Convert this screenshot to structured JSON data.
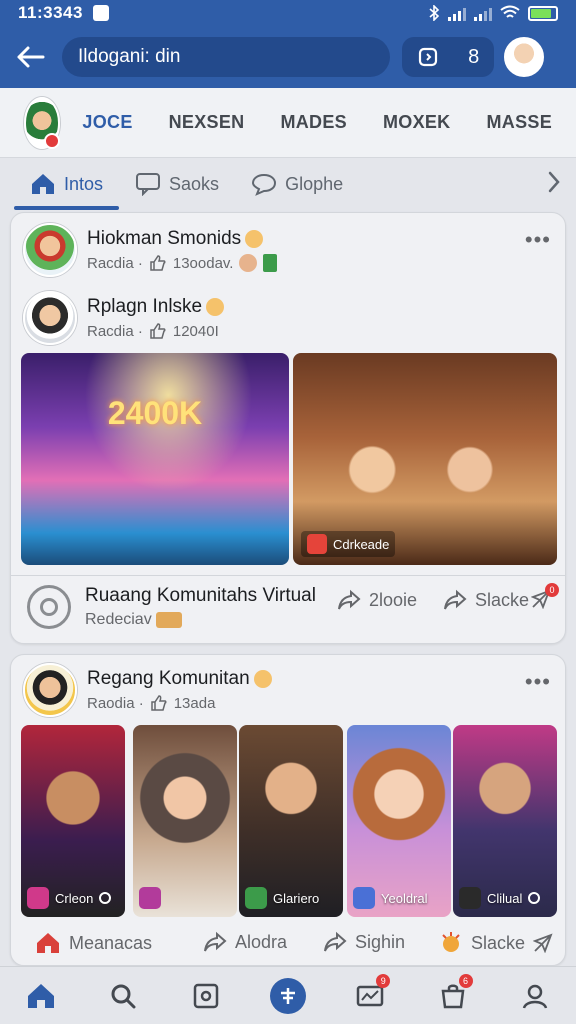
{
  "status_bar": {
    "time": "11:3343"
  },
  "top_bar": {
    "search_text": "Ildogani: din",
    "pill_number": "8"
  },
  "stories": [
    "JOCE",
    "NEXSEN",
    "MADES",
    "MOXEK",
    "MΑSSE"
  ],
  "tabs": [
    {
      "label": "Intos",
      "icon": "home-icon"
    },
    {
      "label": "Saoks",
      "icon": "chat-icon"
    },
    {
      "label": "Glophe",
      "icon": "comment-icon"
    }
  ],
  "post1": {
    "author": "Hiokman Smonids",
    "meta": "Racdia · ",
    "meta_count": "13oodav.",
    "sub_author": "Rplagn Inlske",
    "sub_meta": "Racdia · ",
    "sub_count": "12040I",
    "photo1_text": "2400K",
    "photo2_tag": "Cdrkeade",
    "community_title": "Ruaang Komunitahs Virtual",
    "community_sub": "Redeciav",
    "actions": [
      {
        "label": "2looie",
        "icon": "share-icon"
      },
      {
        "label": "Slacke",
        "icon": "share-icon"
      }
    ],
    "badge": "0"
  },
  "post2": {
    "author": "Regang Komunitan",
    "meta": "Raodia · ",
    "meta_count": "13ada",
    "thumbs": [
      {
        "label": "Crleon",
        "color": "#d0398a"
      },
      {
        "label": "",
        "color": "#b23b9b"
      },
      {
        "label": "Glariero",
        "color": "#3c9b4a"
      },
      {
        "label": "Yeoldral",
        "color": "#4a70d6"
      },
      {
        "label": "Clilual",
        "color": "#2a2a2a"
      }
    ],
    "actions": [
      {
        "label": "Meanacas",
        "icon": "home-icon"
      },
      {
        "label": "Alodra",
        "icon": "share-icon"
      },
      {
        "label": "Sighin",
        "icon": "share-icon"
      },
      {
        "label": "Slacke",
        "icon": "clap-icon"
      }
    ]
  },
  "bottom_nav": {
    "items": [
      "home-icon",
      "search-icon",
      "square-icon",
      "plus-icon",
      "chart-icon",
      "bag-icon",
      "profile-icon"
    ],
    "badges": [
      "9",
      "6"
    ]
  },
  "colors": {
    "brand": "#2f5da8",
    "badge": "#e23b3b"
  }
}
